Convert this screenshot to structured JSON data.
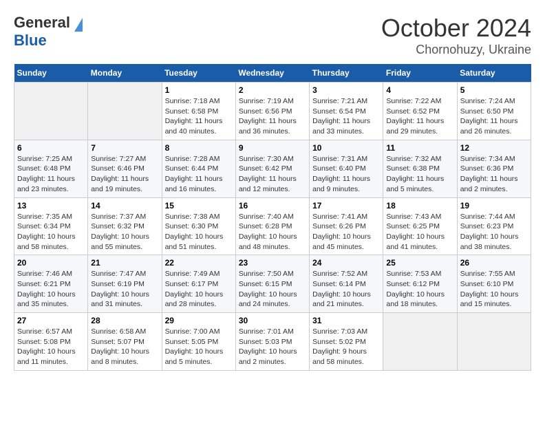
{
  "logo": {
    "line1": "General",
    "line2": "Blue"
  },
  "title": "October 2024",
  "subtitle": "Chornohuzy, Ukraine",
  "weekdays": [
    "Sunday",
    "Monday",
    "Tuesday",
    "Wednesday",
    "Thursday",
    "Friday",
    "Saturday"
  ],
  "weeks": [
    [
      {
        "day": "",
        "detail": ""
      },
      {
        "day": "",
        "detail": ""
      },
      {
        "day": "1",
        "detail": "Sunrise: 7:18 AM\nSunset: 6:58 PM\nDaylight: 11 hours\nand 40 minutes."
      },
      {
        "day": "2",
        "detail": "Sunrise: 7:19 AM\nSunset: 6:56 PM\nDaylight: 11 hours\nand 36 minutes."
      },
      {
        "day": "3",
        "detail": "Sunrise: 7:21 AM\nSunset: 6:54 PM\nDaylight: 11 hours\nand 33 minutes."
      },
      {
        "day": "4",
        "detail": "Sunrise: 7:22 AM\nSunset: 6:52 PM\nDaylight: 11 hours\nand 29 minutes."
      },
      {
        "day": "5",
        "detail": "Sunrise: 7:24 AM\nSunset: 6:50 PM\nDaylight: 11 hours\nand 26 minutes."
      }
    ],
    [
      {
        "day": "6",
        "detail": "Sunrise: 7:25 AM\nSunset: 6:48 PM\nDaylight: 11 hours\nand 23 minutes."
      },
      {
        "day": "7",
        "detail": "Sunrise: 7:27 AM\nSunset: 6:46 PM\nDaylight: 11 hours\nand 19 minutes."
      },
      {
        "day": "8",
        "detail": "Sunrise: 7:28 AM\nSunset: 6:44 PM\nDaylight: 11 hours\nand 16 minutes."
      },
      {
        "day": "9",
        "detail": "Sunrise: 7:30 AM\nSunset: 6:42 PM\nDaylight: 11 hours\nand 12 minutes."
      },
      {
        "day": "10",
        "detail": "Sunrise: 7:31 AM\nSunset: 6:40 PM\nDaylight: 11 hours\nand 9 minutes."
      },
      {
        "day": "11",
        "detail": "Sunrise: 7:32 AM\nSunset: 6:38 PM\nDaylight: 11 hours\nand 5 minutes."
      },
      {
        "day": "12",
        "detail": "Sunrise: 7:34 AM\nSunset: 6:36 PM\nDaylight: 11 hours\nand 2 minutes."
      }
    ],
    [
      {
        "day": "13",
        "detail": "Sunrise: 7:35 AM\nSunset: 6:34 PM\nDaylight: 10 hours\nand 58 minutes."
      },
      {
        "day": "14",
        "detail": "Sunrise: 7:37 AM\nSunset: 6:32 PM\nDaylight: 10 hours\nand 55 minutes."
      },
      {
        "day": "15",
        "detail": "Sunrise: 7:38 AM\nSunset: 6:30 PM\nDaylight: 10 hours\nand 51 minutes."
      },
      {
        "day": "16",
        "detail": "Sunrise: 7:40 AM\nSunset: 6:28 PM\nDaylight: 10 hours\nand 48 minutes."
      },
      {
        "day": "17",
        "detail": "Sunrise: 7:41 AM\nSunset: 6:26 PM\nDaylight: 10 hours\nand 45 minutes."
      },
      {
        "day": "18",
        "detail": "Sunrise: 7:43 AM\nSunset: 6:25 PM\nDaylight: 10 hours\nand 41 minutes."
      },
      {
        "day": "19",
        "detail": "Sunrise: 7:44 AM\nSunset: 6:23 PM\nDaylight: 10 hours\nand 38 minutes."
      }
    ],
    [
      {
        "day": "20",
        "detail": "Sunrise: 7:46 AM\nSunset: 6:21 PM\nDaylight: 10 hours\nand 35 minutes."
      },
      {
        "day": "21",
        "detail": "Sunrise: 7:47 AM\nSunset: 6:19 PM\nDaylight: 10 hours\nand 31 minutes."
      },
      {
        "day": "22",
        "detail": "Sunrise: 7:49 AM\nSunset: 6:17 PM\nDaylight: 10 hours\nand 28 minutes."
      },
      {
        "day": "23",
        "detail": "Sunrise: 7:50 AM\nSunset: 6:15 PM\nDaylight: 10 hours\nand 24 minutes."
      },
      {
        "day": "24",
        "detail": "Sunrise: 7:52 AM\nSunset: 6:14 PM\nDaylight: 10 hours\nand 21 minutes."
      },
      {
        "day": "25",
        "detail": "Sunrise: 7:53 AM\nSunset: 6:12 PM\nDaylight: 10 hours\nand 18 minutes."
      },
      {
        "day": "26",
        "detail": "Sunrise: 7:55 AM\nSunset: 6:10 PM\nDaylight: 10 hours\nand 15 minutes."
      }
    ],
    [
      {
        "day": "27",
        "detail": "Sunrise: 6:57 AM\nSunset: 5:08 PM\nDaylight: 10 hours\nand 11 minutes."
      },
      {
        "day": "28",
        "detail": "Sunrise: 6:58 AM\nSunset: 5:07 PM\nDaylight: 10 hours\nand 8 minutes."
      },
      {
        "day": "29",
        "detail": "Sunrise: 7:00 AM\nSunset: 5:05 PM\nDaylight: 10 hours\nand 5 minutes."
      },
      {
        "day": "30",
        "detail": "Sunrise: 7:01 AM\nSunset: 5:03 PM\nDaylight: 10 hours\nand 2 minutes."
      },
      {
        "day": "31",
        "detail": "Sunrise: 7:03 AM\nSunset: 5:02 PM\nDaylight: 9 hours\nand 58 minutes."
      },
      {
        "day": "",
        "detail": ""
      },
      {
        "day": "",
        "detail": ""
      }
    ]
  ]
}
